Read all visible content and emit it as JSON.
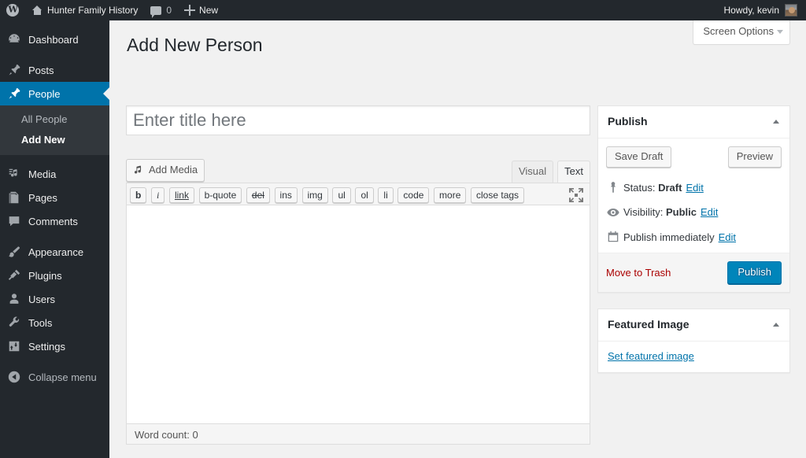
{
  "adminbar": {
    "logo_icon": "wordpress-logo-icon",
    "site_name": "Hunter Family History",
    "home_icon": "home-icon",
    "comments_icon": "comment-bubble-icon",
    "comments_count": "0",
    "new_icon": "plus-icon",
    "new_label": "New",
    "howdy": "Howdy, kevin",
    "avatar": "user-avatar"
  },
  "sidebar": {
    "items": [
      {
        "label": "Dashboard",
        "icon": "dashboard-icon",
        "current": false
      },
      {
        "label": "Posts",
        "icon": "pin-icon",
        "current": false
      },
      {
        "label": "People",
        "icon": "pin-icon",
        "current": true
      },
      {
        "label": "Media",
        "icon": "media-icon",
        "current": false
      },
      {
        "label": "Pages",
        "icon": "pages-icon",
        "current": false
      },
      {
        "label": "Comments",
        "icon": "comment-bubble-icon",
        "current": false
      },
      {
        "label": "Appearance",
        "icon": "paintbrush-icon",
        "current": false
      },
      {
        "label": "Plugins",
        "icon": "plug-icon",
        "current": false
      },
      {
        "label": "Users",
        "icon": "user-icon",
        "current": false
      },
      {
        "label": "Tools",
        "icon": "wrench-icon",
        "current": false
      },
      {
        "label": "Settings",
        "icon": "settings-icon",
        "current": false
      }
    ],
    "submenu": [
      {
        "label": "All People",
        "current": false
      },
      {
        "label": "Add New",
        "current": true
      }
    ],
    "collapse": {
      "label": "Collapse menu",
      "icon": "collapse-arrow-icon"
    },
    "accent_color": "#0073aa",
    "background_color": "#23282d",
    "submenu_background_color": "#32373c"
  },
  "screen_meta": {
    "screen_options_label": "Screen Options",
    "chevron_icon": "chevron-down-icon"
  },
  "page": {
    "title": "Add New Person"
  },
  "title_field": {
    "value": "",
    "placeholder": "Enter title here"
  },
  "editor": {
    "add_media_label": "Add Media",
    "add_media_icon": "add-media-icon",
    "tabs": [
      {
        "label": "Visual",
        "active": false
      },
      {
        "label": "Text",
        "active": true
      }
    ],
    "quicktags": [
      {
        "label": "b",
        "style": "b"
      },
      {
        "label": "i",
        "style": "i"
      },
      {
        "label": "link",
        "style": "lnk"
      },
      {
        "label": "b-quote",
        "style": ""
      },
      {
        "label": "del",
        "style": "del"
      },
      {
        "label": "ins",
        "style": "ins"
      },
      {
        "label": "img",
        "style": ""
      },
      {
        "label": "ul",
        "style": ""
      },
      {
        "label": "ol",
        "style": ""
      },
      {
        "label": "li",
        "style": ""
      },
      {
        "label": "code",
        "style": ""
      },
      {
        "label": "more",
        "style": ""
      },
      {
        "label": "close tags",
        "style": ""
      }
    ],
    "fullscreen_icon": "distraction-free-icon",
    "content": "",
    "word_count_label": "Word count: 0"
  },
  "publish_box": {
    "title": "Publish",
    "save_draft_label": "Save Draft",
    "preview_label": "Preview",
    "status": {
      "icon": "pin-post-icon",
      "prefix": "Status:",
      "value": "Draft",
      "edit_label": "Edit"
    },
    "visibility": {
      "icon": "eye-icon",
      "prefix": "Visibility:",
      "value": "Public",
      "edit_label": "Edit"
    },
    "schedule": {
      "icon": "calendar-icon",
      "text": "Publish immediately",
      "edit_label": "Edit"
    },
    "trash_label": "Move to Trash",
    "publish_label": "Publish",
    "publish_button_color": "#0085ba",
    "trash_color": "#a00"
  },
  "featured_image_box": {
    "title": "Featured Image",
    "set_link_label": "Set featured image"
  }
}
